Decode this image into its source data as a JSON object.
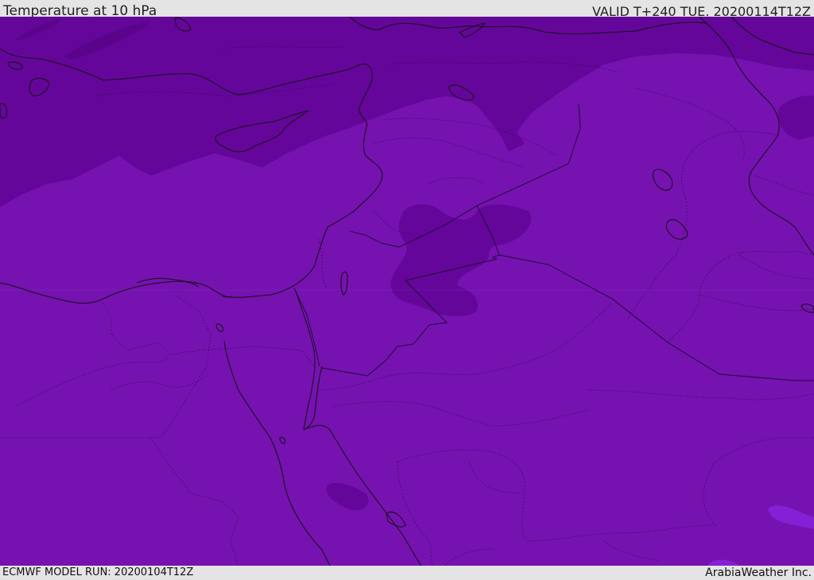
{
  "header": {
    "title": "Temperature at 10 hPa",
    "valid": "VALID T+240 TUE. 20200114T12Z"
  },
  "footer": {
    "model_run": "ECMWF MODEL RUN: 20200104T12Z",
    "credit": "ArabiaWeather Inc."
  },
  "colors": {
    "base_fill": "#7612b0",
    "cold_band_fill": "#65069a",
    "colder_patch_fill": "#5a048c",
    "warm_patch_fill": "#8520d6",
    "frame_background": "#e4e4e4"
  }
}
